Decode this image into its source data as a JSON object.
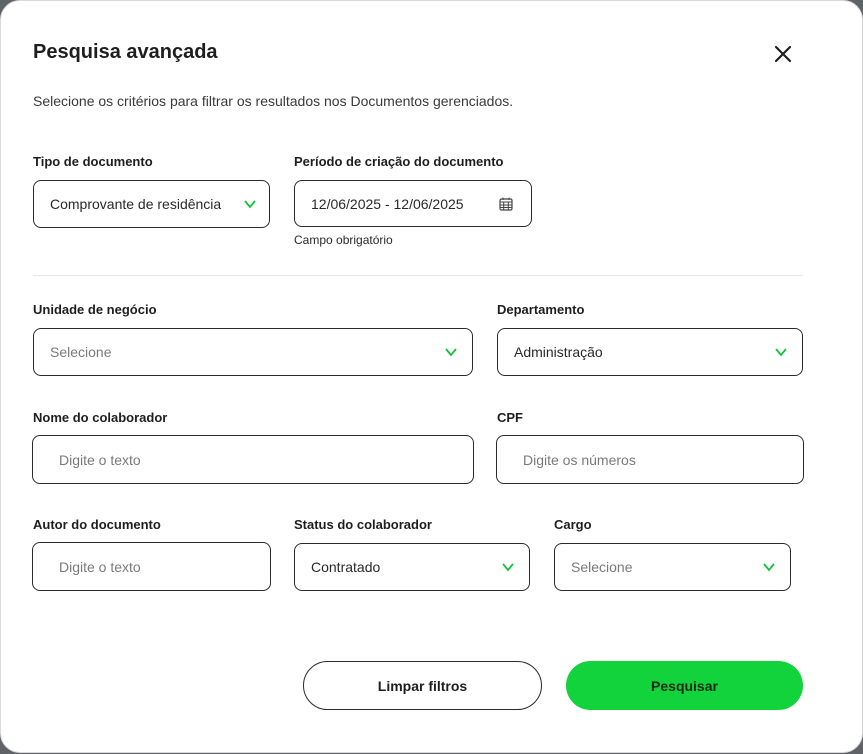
{
  "modal": {
    "title": "Pesquisa avançada",
    "subtitle": "Selecione os critérios para filtrar os resultados nos Documentos gerenciados."
  },
  "fields": {
    "tipo_documento": {
      "label": "Tipo de documento",
      "value": "Comprovante de residência"
    },
    "periodo": {
      "label": "Período de criação do documento",
      "value": "12/06/2025 - 12/06/2025",
      "hint": "Campo obrigatório"
    },
    "unidade_negocio": {
      "label": "Unidade de negócio",
      "placeholder": "Selecione"
    },
    "departamento": {
      "label": "Departamento",
      "value": "Administração"
    },
    "nome_colaborador": {
      "label": "Nome do colaborador",
      "placeholder": "Digite o texto"
    },
    "cpf": {
      "label": "CPF",
      "placeholder": "Digite os números"
    },
    "autor_documento": {
      "label": "Autor do documento",
      "placeholder": "Digite o texto"
    },
    "status_colaborador": {
      "label": "Status do colaborador",
      "value": "Contratado"
    },
    "cargo": {
      "label": "Cargo",
      "placeholder": "Selecione"
    }
  },
  "buttons": {
    "clear_label": "Limpar filtros",
    "search_label": "Pesquisar"
  },
  "colors": {
    "accent": "#12d33c",
    "chevron": "#12c23a",
    "border": "#2b2b2b"
  },
  "icons": [
    "close-icon",
    "chevron-down-icon",
    "calendar-icon"
  ]
}
